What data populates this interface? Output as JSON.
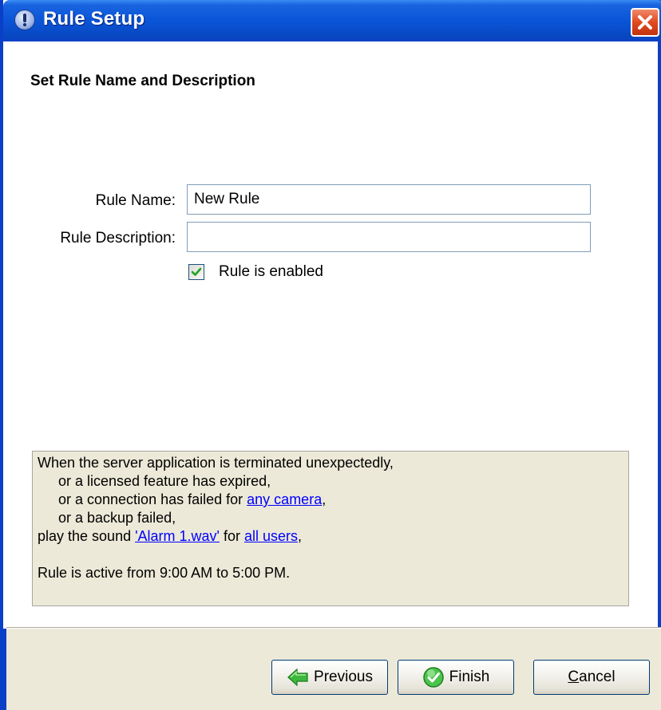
{
  "window": {
    "title": "Rule Setup",
    "title_icon": "clock-icon",
    "close_icon": "close-icon"
  },
  "page": {
    "heading": "Set Rule Name and Description"
  },
  "form": {
    "rule_name_label": "Rule Name:",
    "rule_name_value": "New Rule",
    "rule_description_label": "Rule Description:",
    "rule_description_value": "",
    "enabled_label": "Rule is enabled",
    "enabled_checked": true
  },
  "summary": {
    "line1": "When the server application is terminated unexpectedly,",
    "line2": "or a licensed feature has expired,",
    "line3_prefix": "or a connection has failed for ",
    "line3_link": "any camera",
    "line3_suffix": ",",
    "line4": "or a backup failed,",
    "line5_prefix": "play the sound ",
    "line5_link1": "'Alarm 1.wav'",
    "line5_mid": " for ",
    "line5_link2": "all users",
    "line5_suffix": ",",
    "line6": "Rule is active from 9:00 AM to 5:00 PM."
  },
  "buttons": {
    "previous_label": "Previous",
    "finish_label": "Finish",
    "cancel_label": "Cancel",
    "previous_icon": "left-arrow-icon",
    "finish_icon": "checkmark-icon"
  },
  "colors": {
    "titlebar": "#0a55d8",
    "link": "#0000ff",
    "panel_bg": "#ece9d8",
    "close_button": "#e04a1e"
  }
}
